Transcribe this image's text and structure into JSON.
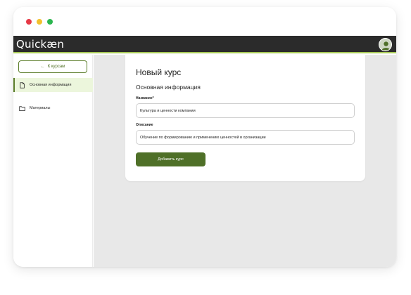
{
  "window": {
    "traffic_lights": [
      "#e63946",
      "#f2c12e",
      "#2bb64f"
    ]
  },
  "appbar": {
    "logo_text": "Quickæn",
    "accent_color": "#a7c957",
    "avatar_icon": "user-avatar-icon"
  },
  "sidebar": {
    "back_button": {
      "arrow": "←",
      "label": "К курсам"
    },
    "items": [
      {
        "label": "Основная информация",
        "icon": "document-icon",
        "active": true
      },
      {
        "label": "Материалы",
        "icon": "folder-icon",
        "active": false
      }
    ]
  },
  "main": {
    "title": "Новый курс",
    "section_title": "Основная информация",
    "fields": [
      {
        "label": "Название*",
        "value": "Культура и ценности компании"
      },
      {
        "label": "Описание",
        "value": "Обучение по формированию и применению ценностей в организации"
      }
    ],
    "submit_label": "Добавить курс",
    "submit_color": "#4f7028"
  }
}
